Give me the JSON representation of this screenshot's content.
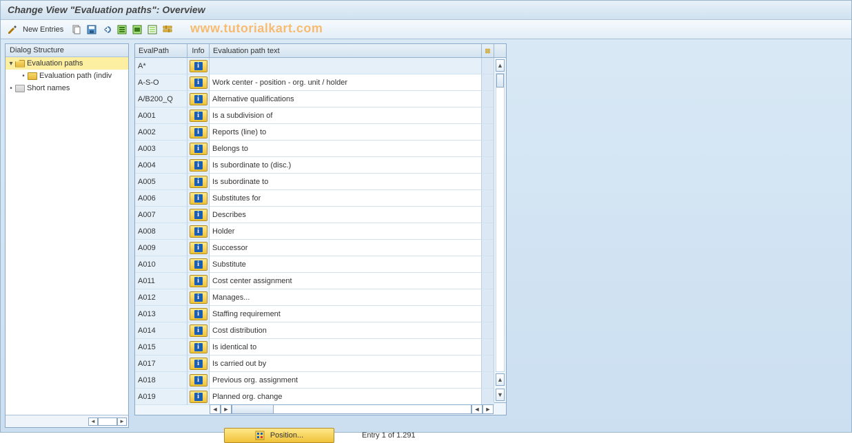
{
  "title": "Change View \"Evaluation paths\": Overview",
  "toolbar": {
    "new_entries": "New Entries"
  },
  "watermark": "www.tutorialkart.com",
  "sidebar": {
    "header": "Dialog Structure",
    "items": [
      {
        "label": "Evaluation paths"
      },
      {
        "label": "Evaluation path (indiv"
      },
      {
        "label": "Short names"
      }
    ]
  },
  "table": {
    "headers": {
      "path": "EvalPath",
      "info": "Info",
      "text": "Evaluation path text"
    },
    "rows": [
      {
        "path": "A*",
        "text": ""
      },
      {
        "path": "A-S-O",
        "text": "Work center - position - org. unit / holder"
      },
      {
        "path": "A/B200_Q",
        "text": "Alternative qualifications"
      },
      {
        "path": "A001",
        "text": "Is a subdivision of"
      },
      {
        "path": "A002",
        "text": "Reports (line) to"
      },
      {
        "path": "A003",
        "text": "Belongs to"
      },
      {
        "path": "A004",
        "text": "Is subordinate to (disc.)"
      },
      {
        "path": "A005",
        "text": "Is subordinate to"
      },
      {
        "path": "A006",
        "text": "Substitutes for"
      },
      {
        "path": "A007",
        "text": "Describes"
      },
      {
        "path": "A008",
        "text": "Holder"
      },
      {
        "path": "A009",
        "text": "Successor"
      },
      {
        "path": "A010",
        "text": "Substitute"
      },
      {
        "path": "A011",
        "text": "Cost center assignment"
      },
      {
        "path": "A012",
        "text": "Manages..."
      },
      {
        "path": "A013",
        "text": "Staffing requirement"
      },
      {
        "path": "A014",
        "text": "Cost distribution"
      },
      {
        "path": "A015",
        "text": "Is identical to"
      },
      {
        "path": "A017",
        "text": "Is carried out by"
      },
      {
        "path": "A018",
        "text": "Previous org. assignment"
      },
      {
        "path": "A019",
        "text": "Planned org. change"
      }
    ]
  },
  "footer": {
    "position_btn": "Position...",
    "entry_status": "Entry 1 of 1.291"
  }
}
